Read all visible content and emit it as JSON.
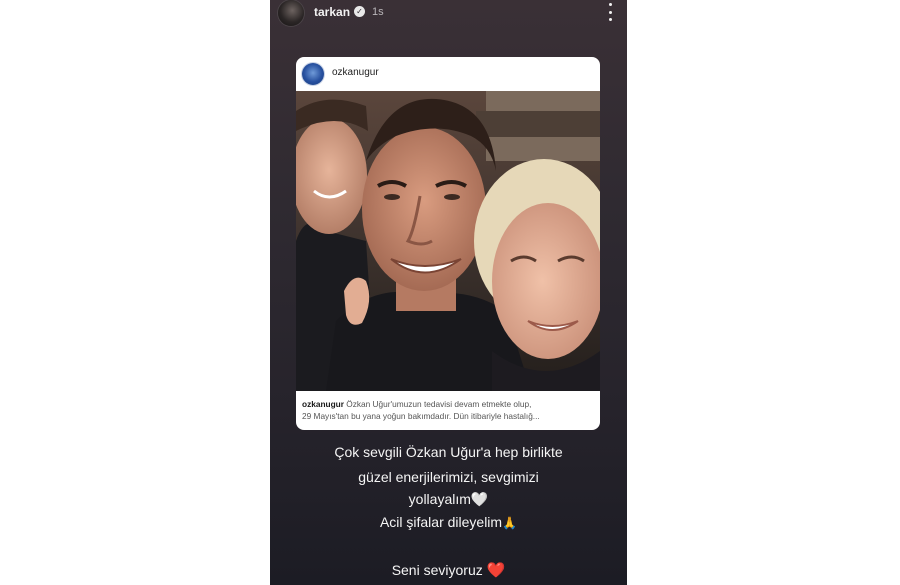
{
  "story": {
    "username": "tarkan",
    "time": "1s",
    "verified_icon": "verified-check-icon",
    "more_icon": "more-vertical-icon"
  },
  "post": {
    "username": "ozkanugur",
    "caption_user": "ozkanugur",
    "caption_line1": "Özkan Uğur'umuzun tedavisi devam etmekte olup,",
    "caption_line2": "29 Mayıs'tan bu yana yoğun bakımdadır. Dün itibariyle hastalığ...",
    "image": "selfie-three-people"
  },
  "message": {
    "line1": "Çok sevgili Özkan Uğur'a hep birlikte",
    "line2": "güzel enerjilerimizi, sevgimizi",
    "line3": "yollayalım",
    "line3_emoji": "🤍",
    "line4": "Acil şifalar dileyelim",
    "line4_emoji": "🙏",
    "line5": "Seni seviyoruz",
    "line5_emoji": "❤️"
  },
  "colors": {
    "story_bg": "#2f2a31",
    "text": "#f5f5f5",
    "heart_red": "#e0182d"
  }
}
